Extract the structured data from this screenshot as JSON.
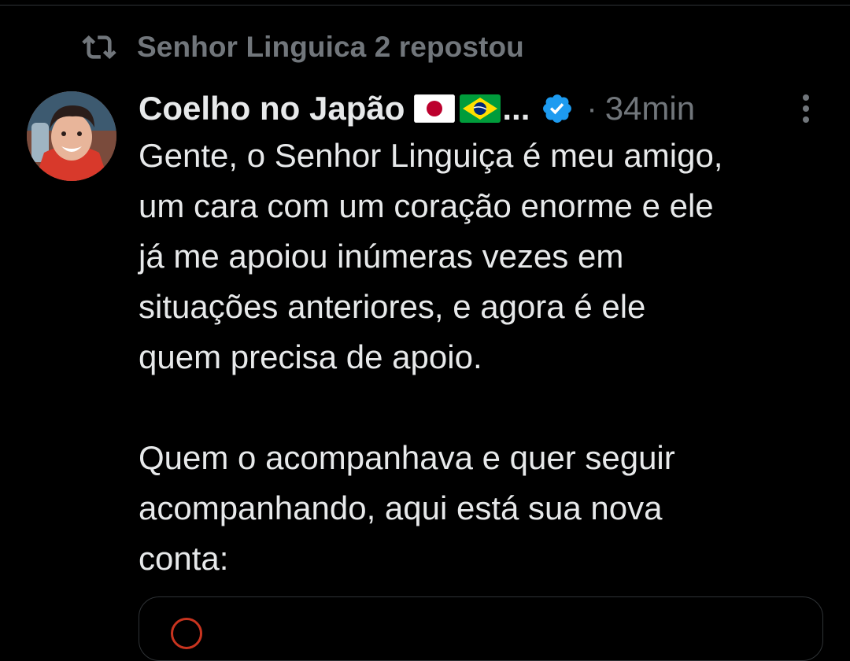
{
  "repost": {
    "icon": "repost-icon",
    "text": "Senhor Linguica 2 repostou"
  },
  "tweet": {
    "author": {
      "display_name": "Coelho no Japão",
      "flags": [
        "japan-flag-icon",
        "brazil-flag-icon"
      ],
      "truncation": "...",
      "verified_icon": "verified-badge-icon"
    },
    "time_separator": "·",
    "time": "34min",
    "more_icon": "more-vertical-icon",
    "lines": [
      "Gente, o Senhor Linguiça é meu amigo,",
      "um cara com um coração enorme e ele",
      "já me apoiou inúmeras vezes em",
      "situações anteriores, e agora é ele",
      "quem precisa de apoio."
    ],
    "lines2": [
      "Quem o acompanhava e quer seguir",
      "acompanhando, aqui está sua nova",
      "conta:"
    ]
  },
  "colors": {
    "background": "#000000",
    "text_primary": "#e7e9ea",
    "text_secondary": "#71767b",
    "verified_blue": "#1d9bf0",
    "border": "#2f3336"
  }
}
